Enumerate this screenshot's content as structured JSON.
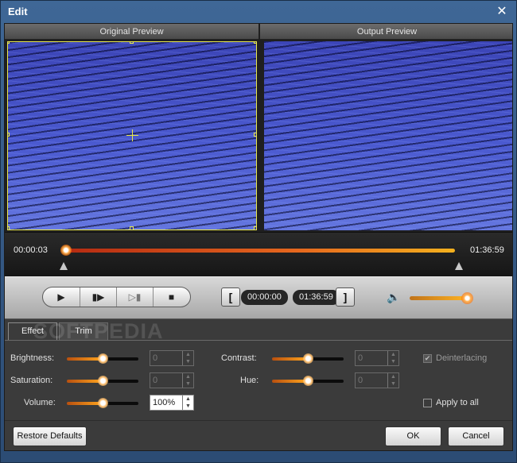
{
  "window": {
    "title": "Edit"
  },
  "preview": {
    "original_label": "Original Preview",
    "output_label": "Output Preview"
  },
  "timeline": {
    "current_time": "00:00:03",
    "total_time": "01:36:59",
    "progress": 0.0
  },
  "controls": {
    "play_icon": "play-icon",
    "step_icon": "step-forward-icon",
    "frame_icon": "next-frame-icon",
    "stop_icon": "stop-icon",
    "set_start_label": "[",
    "start_time": "00:00:00",
    "end_time": "01:36:59",
    "set_end_label": "]",
    "volume_level": 1.0
  },
  "tabs": [
    {
      "label": "Effect",
      "active": true
    },
    {
      "label": "Trim",
      "active": false
    }
  ],
  "watermark": "SOFTPEDIA",
  "effect": {
    "brightness": {
      "label": "Brightness:",
      "value": "0",
      "level": 0.5
    },
    "contrast": {
      "label": "Contrast:",
      "value": "0",
      "level": 0.5
    },
    "saturation": {
      "label": "Saturation:",
      "value": "0",
      "level": 0.5
    },
    "hue": {
      "label": "Hue:",
      "value": "0",
      "level": 0.5
    },
    "volume": {
      "label": "Volume:",
      "value": "100%",
      "level": 0.5
    },
    "deinterlacing": {
      "label": "Deinterlacing",
      "checked": true,
      "enabled": false
    },
    "apply_to_all": {
      "label": "Apply to all",
      "checked": false
    }
  },
  "buttons": {
    "restore_defaults": "Restore Defaults",
    "ok": "OK",
    "cancel": "Cancel"
  },
  "colors": {
    "accent": "#ff8a1e",
    "frame": "#2c4c74",
    "panel": "#3b3b3b",
    "crop_outline": "#e8e84a"
  }
}
